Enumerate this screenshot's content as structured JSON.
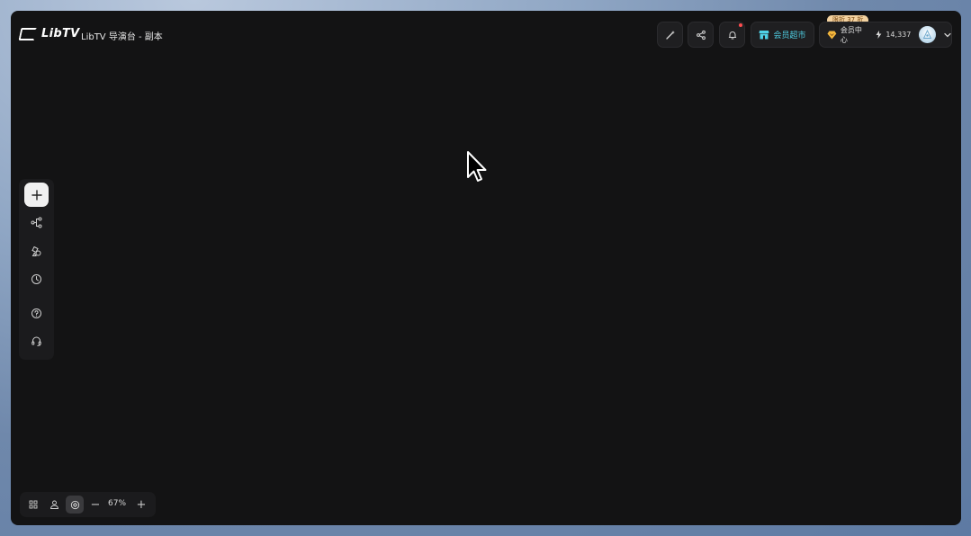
{
  "header": {
    "logo_text": "LibTV",
    "doc_title": "LibTV 导演台 - 副本",
    "buttons": {
      "magic_icon": "magic-wand-icon",
      "share_icon": "share-icon",
      "bell_icon": "bell-icon"
    },
    "shop_label": "会员超市",
    "discount_badge": "限折 37 折",
    "vip_label": "会员中心",
    "credits": "14,337"
  },
  "left_toolbar": {
    "items": [
      "add-icon",
      "workflow-icon",
      "assets-icon",
      "history-icon",
      "help-icon",
      "support-icon"
    ]
  },
  "bottom_bar": {
    "items": [
      "grid-icon",
      "people-icon",
      "pan-icon"
    ],
    "zoom_out": "−",
    "zoom_level": "67%",
    "zoom_in": "+"
  },
  "colors": {
    "canvas": "#131314",
    "accent_shop": "#4fd1e6",
    "badge_bg": "#f3d2a0",
    "notification": "#ff4d4f"
  }
}
